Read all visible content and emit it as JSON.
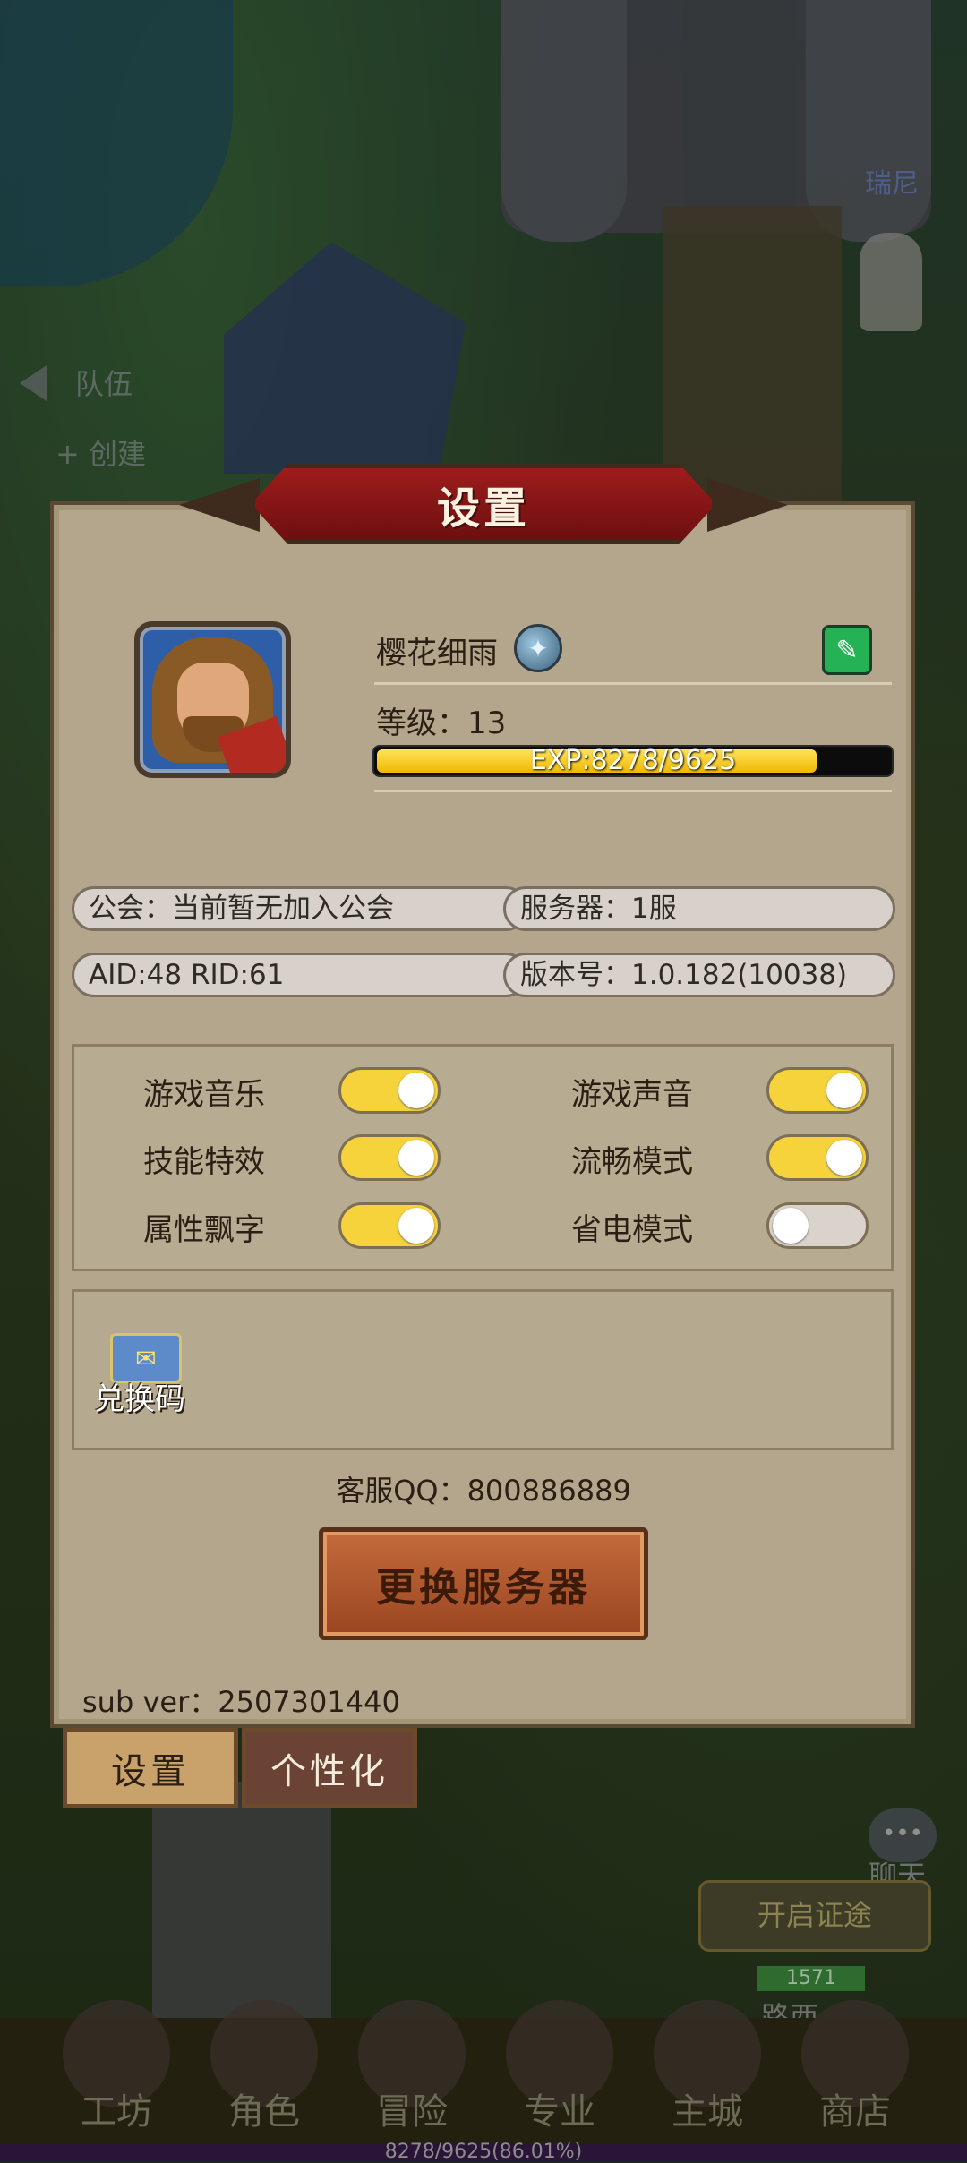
{
  "background": {
    "team_label": "队伍",
    "create_label": "+ 创建",
    "npc_name": "瑞尼",
    "chat_label": "聊天",
    "event_badge": "开启证途",
    "level_badge": "1571",
    "road_label": "路西"
  },
  "dialog": {
    "title": "设置",
    "player": {
      "name": "樱花细雨",
      "level_label": "等级：13",
      "exp_text": "EXP:8278/9625",
      "exp_fraction": 0.86
    },
    "info": {
      "guild": "公会：当前暂无加入公会",
      "server": "服务器：1服",
      "ids": "AID:48  RID:61",
      "version": "版本号：1.0.182(10038)"
    },
    "toggles": [
      {
        "label": "游戏音乐",
        "state": "on"
      },
      {
        "label": "游戏声音",
        "state": "on"
      },
      {
        "label": "技能特效",
        "state": "on"
      },
      {
        "label": "流畅模式",
        "state": "on"
      },
      {
        "label": "属性飘字",
        "state": "on"
      },
      {
        "label": "省电模式",
        "state": "off"
      }
    ],
    "redeem_label": "兑换码",
    "service_qq": "客服QQ：800886889",
    "change_server_button": "更换服务器",
    "sub_ver": "sub ver：2507301440"
  },
  "tabs": {
    "settings": "设置",
    "personalize": "个性化"
  },
  "bottom_nav": {
    "items": [
      "工坊",
      "角色",
      "冒险",
      "专业",
      "主城",
      "商店"
    ],
    "exp_text": "8278/9625(86.01%)"
  },
  "colors": {
    "panel_bg": "#b3a68c",
    "banner_red": "#9e1c1c",
    "toggle_on": "#f6d33a",
    "toggle_off": "#d9d3cc",
    "edit_green": "#24b255"
  }
}
